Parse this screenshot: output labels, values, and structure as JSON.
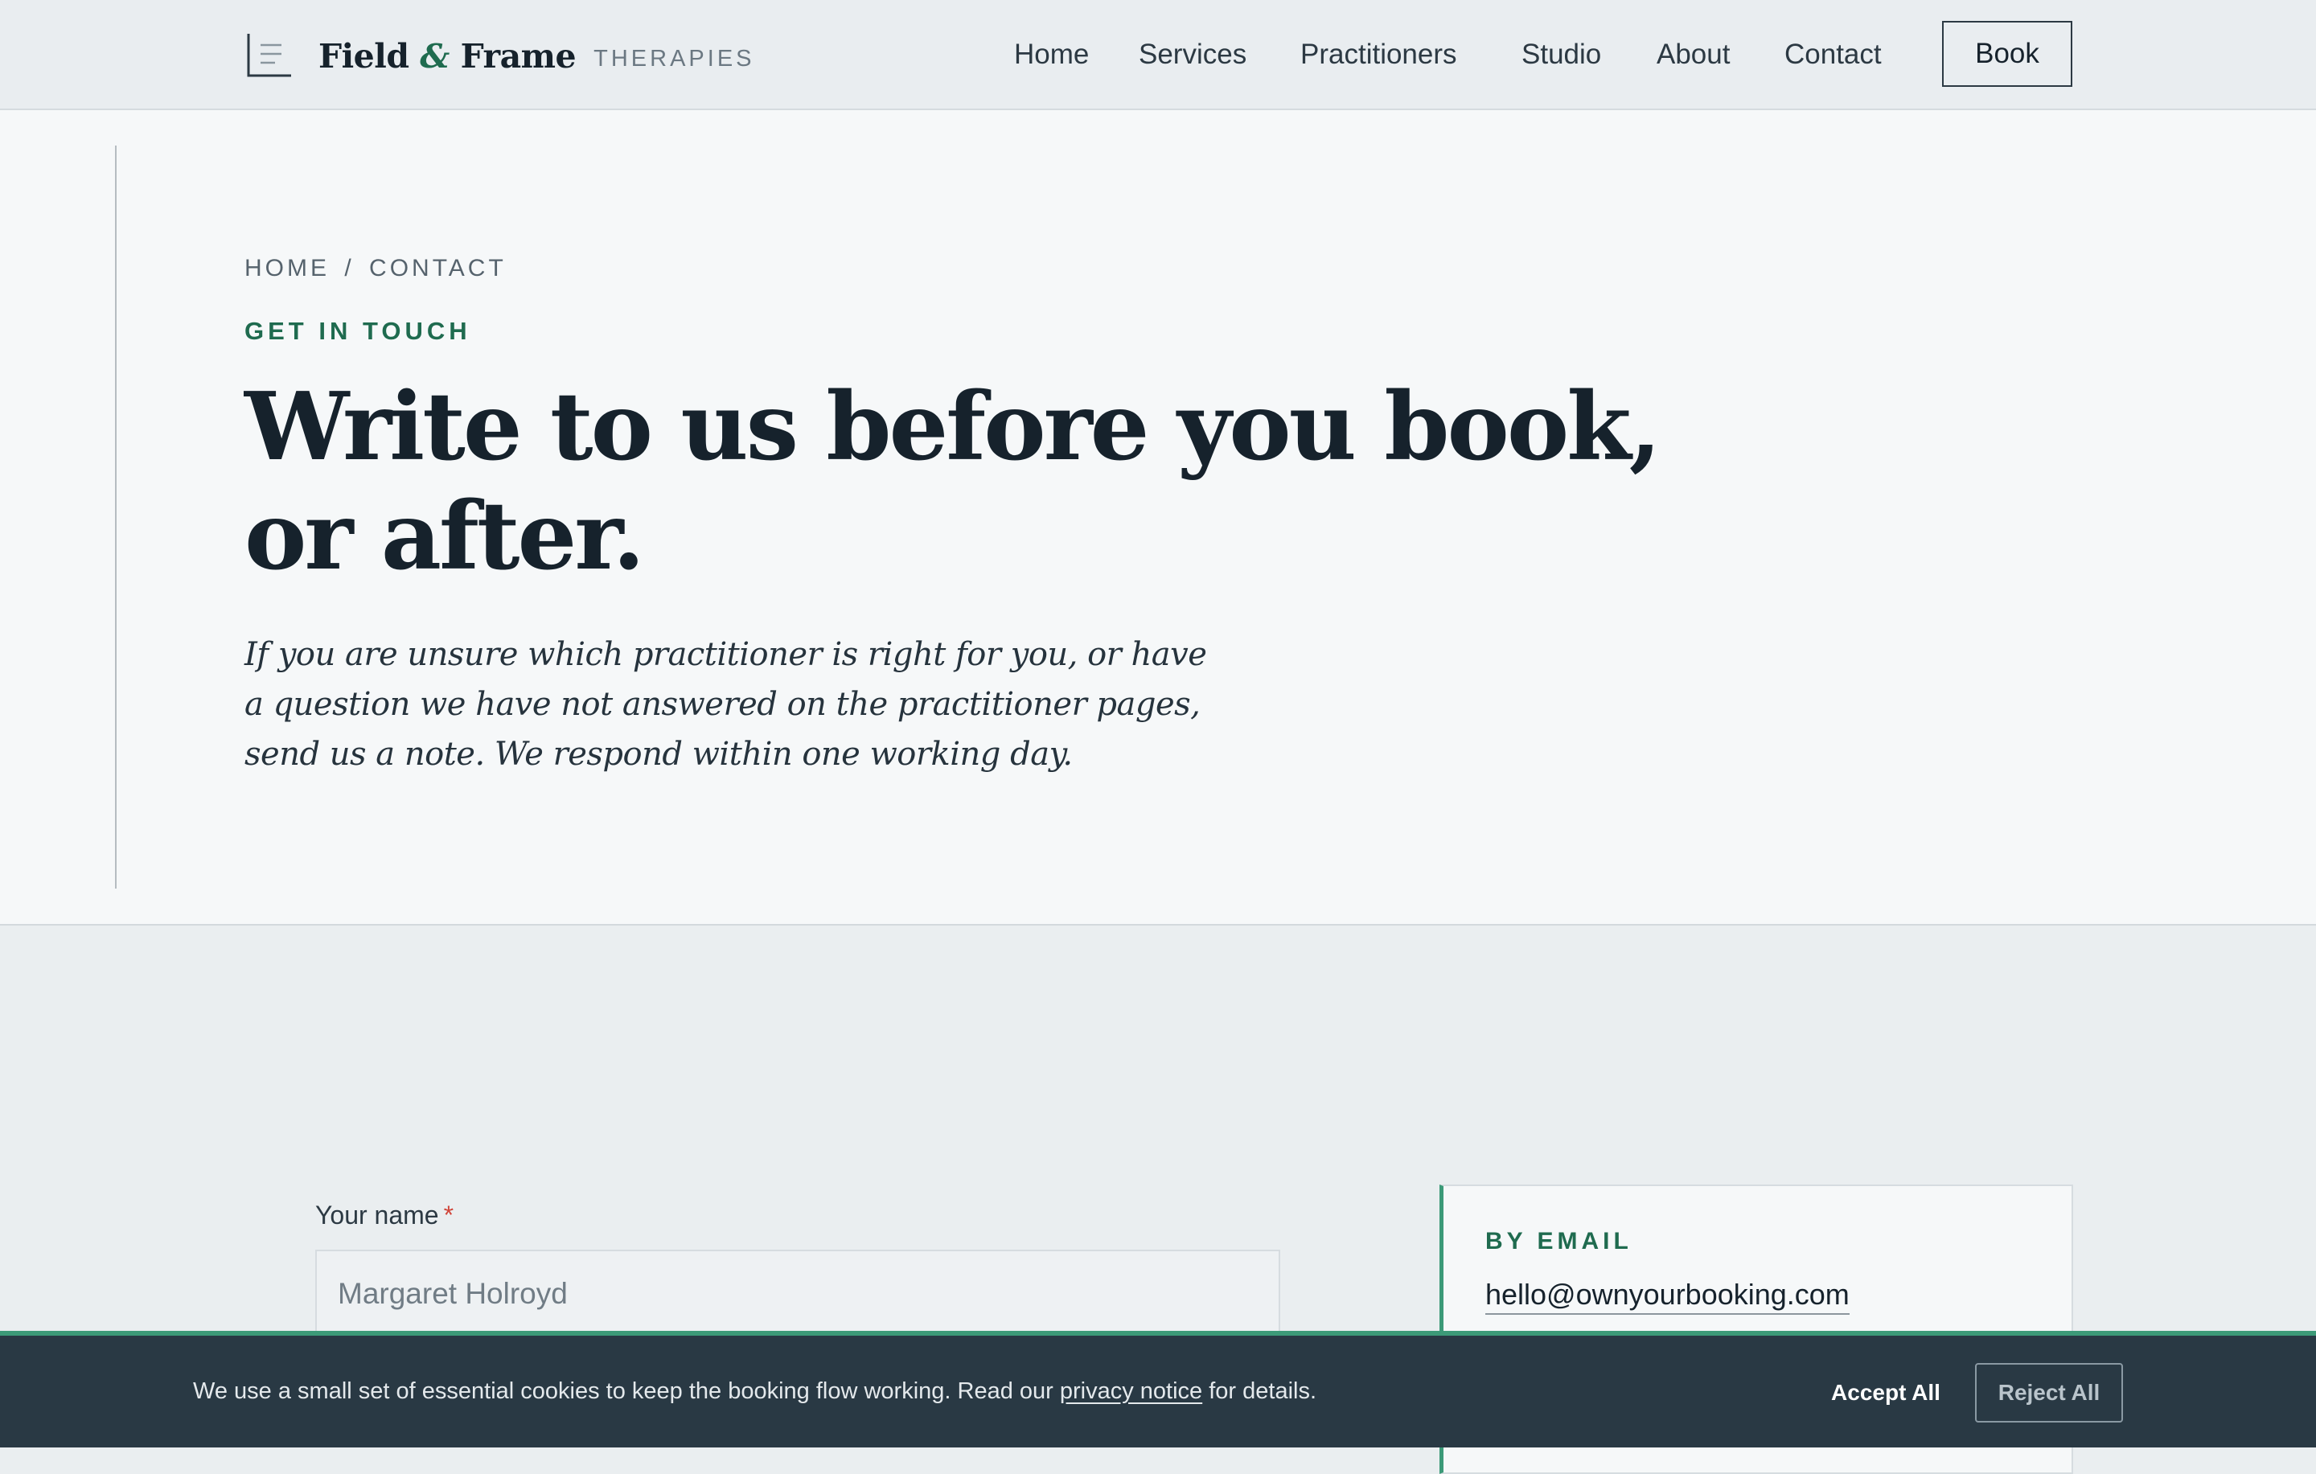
{
  "header": {
    "brand": {
      "part1": "Field",
      "amp": "&",
      "part2": "Frame",
      "tagline": "THERAPIES"
    },
    "nav": [
      {
        "label": "Home"
      },
      {
        "label": "Services"
      },
      {
        "label": "Practitioners"
      },
      {
        "label": "Studio"
      },
      {
        "label": "About"
      },
      {
        "label": "Contact"
      }
    ],
    "book_label": "Book"
  },
  "hero": {
    "breadcrumb": {
      "home": "HOME",
      "separator": "/",
      "current": "CONTACT"
    },
    "eyebrow": "GET IN TOUCH",
    "headline": "Write to us before you book, or after.",
    "lede": "If you are unsure which practitioner is right for you, or have a question we have not answered on the practitioner pages, send us a note. We respond within one working day."
  },
  "form": {
    "name_label": "Your name",
    "required_mark": "*",
    "name_placeholder": "Margaret Holroyd"
  },
  "contact": {
    "email_heading": "BY EMAIL",
    "email": "hello@ownyourbooking.com"
  },
  "cookie": {
    "text_before": "We use a small set of essential cookies to keep the booking flow working. Read our ",
    "link_label": "privacy notice",
    "text_after": " for details.",
    "accept_label": "Accept All",
    "reject_label": "Reject All"
  },
  "colors": {
    "accent_green": "#1f6b4f",
    "accent_green_light": "#3c9a78",
    "ink": "#16222c",
    "banner_bg": "#293944",
    "required_red": "#d0453a"
  },
  "icons": {
    "logo": "document-lines-icon"
  }
}
